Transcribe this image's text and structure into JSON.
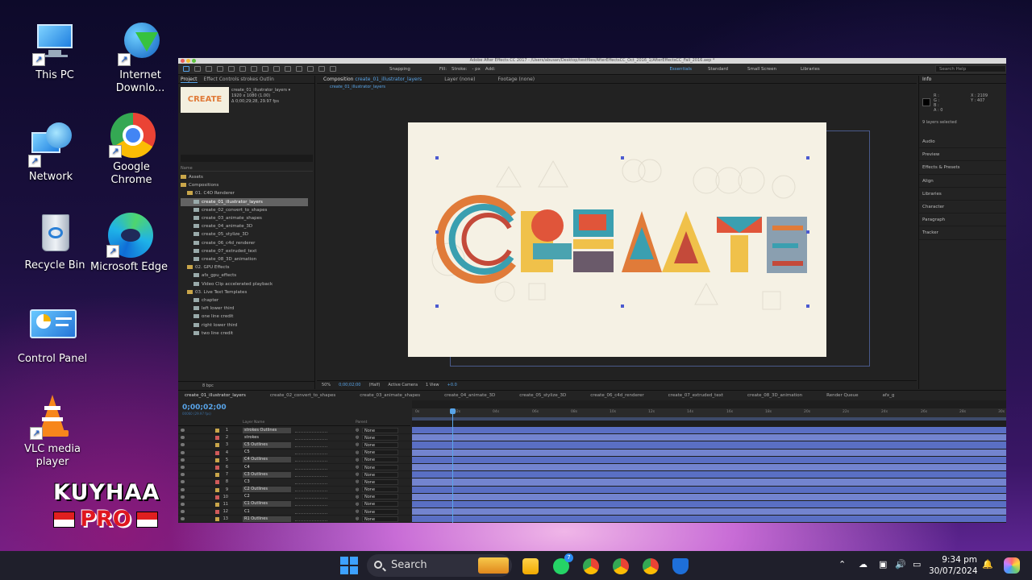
{
  "desktop": {
    "icons": [
      {
        "label": "This PC",
        "icon": "this-pc-icon"
      },
      {
        "label": "Internet Downlo...",
        "icon": "idm-icon"
      },
      {
        "label": "Network",
        "icon": "network-icon"
      },
      {
        "label": "Google Chrome",
        "icon": "chrome-icon"
      },
      {
        "label": "Recycle Bin",
        "icon": "recycle-bin-icon"
      },
      {
        "label": "Microsoft Edge",
        "icon": "edge-icon"
      },
      {
        "label": "Control Panel",
        "icon": "control-panel-icon"
      },
      {
        "label": "VLC media player",
        "icon": "vlc-icon"
      }
    ],
    "watermark": {
      "line1": "KUYHAA",
      "line2": "PRO"
    }
  },
  "ae": {
    "title": "Adobe After Effects CC 2017 - /Users/abusan/Desktop/testfiles/AfterEffectsCC_Oct_2016_1/AfterEffectsCC_Fall_2016.aep *",
    "toolbar": {
      "snapping": "Snapping",
      "fill": "Fill:",
      "stroke": "Stroke:",
      "px": "- px",
      "add": "Add:",
      "workspaces": [
        "Essentials",
        "Standard",
        "Small Screen",
        "Libraries"
      ],
      "search_help": "Search Help"
    },
    "project": {
      "tabs": [
        "Project",
        "Effect Controls strokes Outlin"
      ],
      "thumb_text": "CREATE",
      "comp_name": "create_01_illustrator_layers ▾",
      "comp_size": "1920 x 1080 (1.00)",
      "comp_duration": "Δ 0;00;29;28, 29.97 fps",
      "col_name": "Name",
      "items": [
        {
          "label": "Assets",
          "kind": "folder",
          "indent": 0
        },
        {
          "label": "Compositions",
          "kind": "folder",
          "indent": 0
        },
        {
          "label": "01. C4D Renderer",
          "kind": "folder",
          "indent": 1
        },
        {
          "label": "create_01_illustrator_layers",
          "kind": "comp",
          "indent": 2,
          "selected": true
        },
        {
          "label": "create_02_convert_to_shapes",
          "kind": "comp",
          "indent": 2
        },
        {
          "label": "create_03_animate_shapes",
          "kind": "comp",
          "indent": 2
        },
        {
          "label": "create_04_animate_3D",
          "kind": "comp",
          "indent": 2
        },
        {
          "label": "create_05_stylize_3D",
          "kind": "comp",
          "indent": 2
        },
        {
          "label": "create_06_c4d_renderer",
          "kind": "comp",
          "indent": 2
        },
        {
          "label": "create_07_extruded_text",
          "kind": "comp",
          "indent": 2
        },
        {
          "label": "create_08_3D_animation",
          "kind": "comp",
          "indent": 2
        },
        {
          "label": "02. GPU Effects",
          "kind": "folder",
          "indent": 1
        },
        {
          "label": "afx_gpu_effects",
          "kind": "comp",
          "indent": 2
        },
        {
          "label": "Video Clip accelerated playback",
          "kind": "comp",
          "indent": 2
        },
        {
          "label": "03. Live Text Templates",
          "kind": "folder",
          "indent": 1
        },
        {
          "label": "chapter",
          "kind": "comp",
          "indent": 2
        },
        {
          "label": "left lower third",
          "kind": "comp",
          "indent": 2
        },
        {
          "label": "one line credit",
          "kind": "comp",
          "indent": 2
        },
        {
          "label": "right lower third",
          "kind": "comp",
          "indent": 2
        },
        {
          "label": "two line credit",
          "kind": "comp",
          "indent": 2
        }
      ],
      "footer_bpc": "8 bpc"
    },
    "composition": {
      "tab_label": "Composition",
      "tab_comp": "create_01_illustrator_layers",
      "layer_tab": "Layer (none)",
      "footage_tab": "Footage (none)",
      "sub_tab": "create_01_illustrator_layers",
      "art_text": "CREATE",
      "footer": {
        "zoom": "50%",
        "timecode": "0;00;02;00",
        "resolution": "(Half)",
        "camera": "Active Camera",
        "views": "1 View",
        "offset": "+0.0"
      }
    },
    "info": {
      "title": "Info",
      "r": "R :",
      "g": "G :",
      "b": "B :",
      "a": "A : 0",
      "x": "X : 2109",
      "y": "Y : 407",
      "status": "9 layers selected",
      "panels": [
        "Audio",
        "Preview",
        "Effects & Presets",
        "Align",
        "Libraries",
        "Character",
        "Paragraph",
        "Tracker"
      ]
    },
    "timeline": {
      "tabs": [
        "create_01_illustrator_layers",
        "create_02_convert_to_shapes",
        "create_03_animate_shapes",
        "create_04_animate_3D",
        "create_05_stylize_3D",
        "create_06_c4d_renderer",
        "create_07_extruded_text",
        "create_08_3D_animation",
        "Render Queue",
        "afx_g"
      ],
      "timecode": "0;00;02;00",
      "timecode_sub": "00060 (29.97 fps)",
      "col_layer_name": "Layer Name",
      "col_parent": "Parent",
      "ruler": [
        "0s",
        "02s",
        "04s",
        "06s",
        "08s",
        "10s",
        "12s",
        "14s",
        "16s",
        "18s",
        "20s",
        "22s",
        "24s",
        "26s",
        "28s",
        "30s"
      ],
      "layers": [
        {
          "num": "1",
          "name": "strokes Outlines",
          "boxed": true,
          "color": "#c9a64a"
        },
        {
          "num": "2",
          "name": "strokes",
          "boxed": false,
          "color": "#d05a5a"
        },
        {
          "num": "3",
          "name": "C5 Outlines",
          "boxed": true,
          "color": "#c9a64a"
        },
        {
          "num": "4",
          "name": "C5",
          "boxed": false,
          "color": "#d05a5a"
        },
        {
          "num": "5",
          "name": "C4 Outlines",
          "boxed": true,
          "color": "#c9a64a"
        },
        {
          "num": "6",
          "name": "C4",
          "boxed": false,
          "color": "#d05a5a"
        },
        {
          "num": "7",
          "name": "C3 Outlines",
          "boxed": true,
          "color": "#c9a64a"
        },
        {
          "num": "8",
          "name": "C3",
          "boxed": false,
          "color": "#d05a5a"
        },
        {
          "num": "9",
          "name": "C2 Outlines",
          "boxed": true,
          "color": "#c9a64a"
        },
        {
          "num": "10",
          "name": "C2",
          "boxed": false,
          "color": "#d05a5a"
        },
        {
          "num": "11",
          "name": "C1 Outlines",
          "boxed": true,
          "color": "#c9a64a"
        },
        {
          "num": "12",
          "name": "C1",
          "boxed": false,
          "color": "#d05a5a"
        },
        {
          "num": "13",
          "name": "R1 Outlines",
          "boxed": true,
          "color": "#c9a64a"
        }
      ],
      "parent_value": "None"
    }
  },
  "taskbar": {
    "search_placeholder": "Search",
    "whatsapp_badge": "7",
    "time": "9:34 pm",
    "date": "30/07/2024"
  }
}
